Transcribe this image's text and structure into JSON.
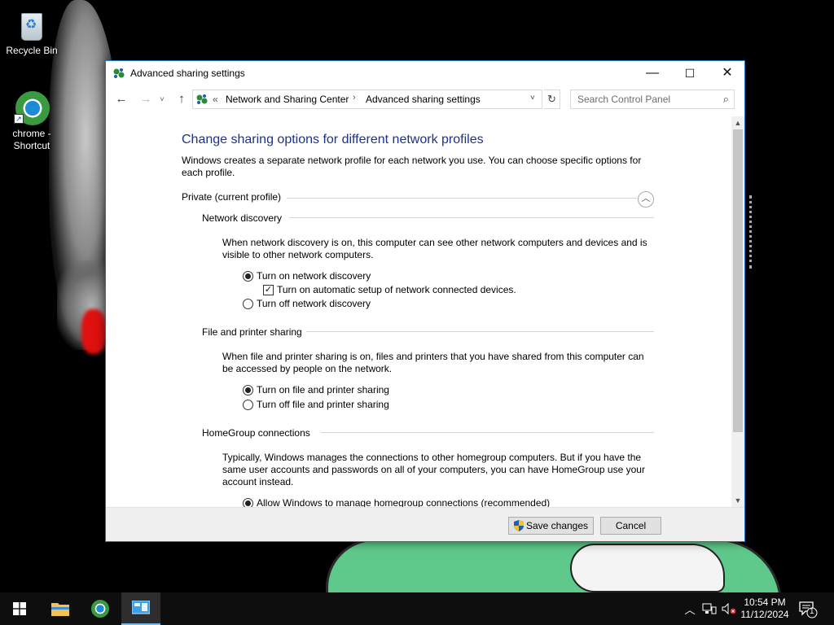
{
  "desktop": {
    "icons": [
      {
        "label": "Recycle Bin",
        "icon": "recycle-bin-icon"
      },
      {
        "label": "chrome - Shortcut",
        "icon": "chrome-icon"
      }
    ]
  },
  "window": {
    "title": "Advanced sharing settings",
    "controls": {
      "minimize": "—",
      "maximize": "☐",
      "close": "✕"
    },
    "nav": {
      "back": "←",
      "forward": "→",
      "recent": "˅",
      "up": "↑",
      "breadcrumb_prefix": "«",
      "breadcrumbs": [
        "Network and Sharing Center",
        "Advanced sharing settings"
      ],
      "separator": "›",
      "dropdown": "˅",
      "refresh": "↻",
      "search_placeholder": "Search Control Panel"
    },
    "content": {
      "heading": "Change sharing options for different network profiles",
      "intro": "Windows creates a separate network profile for each network you use. You can choose specific options for each profile.",
      "profile": {
        "label": "Private (current profile)",
        "collapse": "︿"
      },
      "network_discovery": {
        "title": "Network discovery",
        "description": "When network discovery is on, this computer can see other network computers and devices and is visible to other network computers.",
        "option_on": "Turn on network discovery",
        "option_auto_setup": "Turn on automatic setup of network connected devices.",
        "option_off": "Turn off network discovery",
        "selected": "on",
        "auto_setup_checked": true
      },
      "file_printer_sharing": {
        "title": "File and printer sharing",
        "description": "When file and printer sharing is on, files and printers that you have shared from this computer can be accessed by people on the network.",
        "option_on": "Turn on file and printer sharing",
        "option_off": "Turn off file and printer sharing",
        "selected": "on"
      },
      "homegroup": {
        "title": "HomeGroup connections",
        "description": "Typically, Windows manages the connections to other homegroup computers. But if you have the same user accounts and passwords on all of your computers, you can have HomeGroup use your account instead.",
        "option_windows": "Allow Windows to manage homegroup connections (recommended)",
        "selected": "windows"
      }
    },
    "footer": {
      "save_label": "Save changes",
      "cancel_label": "Cancel"
    }
  },
  "taskbar": {
    "items": [
      "start",
      "file-explorer",
      "chrome",
      "control-panel"
    ],
    "active": "control-panel",
    "clock": {
      "time": "10:54 PM",
      "date": "11/12/2024"
    },
    "notification_count": "1"
  },
  "colors": {
    "heading": "#1e3287",
    "window_border": "#1a73c7",
    "taskbar": "#0e0e0e",
    "active_task_underline": "#76b9ed"
  }
}
